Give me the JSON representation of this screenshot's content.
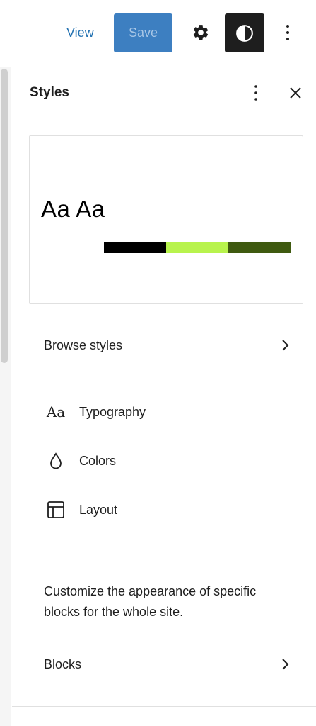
{
  "toolbar": {
    "view_label": "View",
    "save_label": "Save",
    "settings_icon": "gear-icon",
    "styles_icon": "half-circle-contrast-icon",
    "options_icon": "vertical-ellipsis-icon"
  },
  "panel": {
    "title": "Styles",
    "more_icon": "vertical-ellipsis-icon",
    "close_icon": "close-icon"
  },
  "preview": {
    "sample_text": "Aa Aa",
    "swatches": [
      "#000000",
      "#b8f34d",
      "#3f5a10"
    ]
  },
  "browse_styles": {
    "label": "Browse styles",
    "icon": "chevron-right-icon"
  },
  "menu": [
    {
      "label": "Typography",
      "icon": "typography-icon",
      "glyph": "Aa"
    },
    {
      "label": "Colors",
      "icon": "droplet-icon"
    },
    {
      "label": "Layout",
      "icon": "layout-icon"
    }
  ],
  "blocks": {
    "description": "Customize the appearance of specific blocks for the whole site.",
    "label": "Blocks",
    "icon": "chevron-right-icon"
  },
  "colors": {
    "accent": "#2271b1",
    "save_bg": "#3d7fc1",
    "active_button_bg": "#1e1e1e"
  }
}
